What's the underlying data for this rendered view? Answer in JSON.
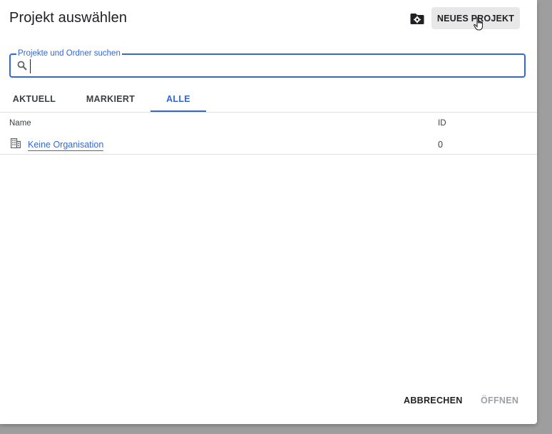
{
  "dialog": {
    "title": "Projekt auswählen",
    "new_project_label": "NEUES PROJEKT",
    "folder_settings_icon": "folder-gear-icon"
  },
  "search": {
    "label": "Projekte und Ordner suchen",
    "value": "",
    "placeholder": "",
    "icon": "search-icon"
  },
  "tabs": [
    {
      "label": "AKTUELL",
      "active": false
    },
    {
      "label": "MARKIERT",
      "active": false
    },
    {
      "label": "ALLE",
      "active": true
    }
  ],
  "table": {
    "columns": [
      "Name",
      "ID"
    ],
    "rows": [
      {
        "icon": "organization-icon",
        "name": "Keine Organisation",
        "id": "0"
      }
    ]
  },
  "actions": {
    "cancel_label": "ABBRECHEN",
    "open_label": "ÖFFNEN"
  },
  "colors": {
    "accent": "#3367d6",
    "text": "#202124",
    "disabled": "#9aa0a6",
    "backdrop": "#9e9e9e"
  }
}
